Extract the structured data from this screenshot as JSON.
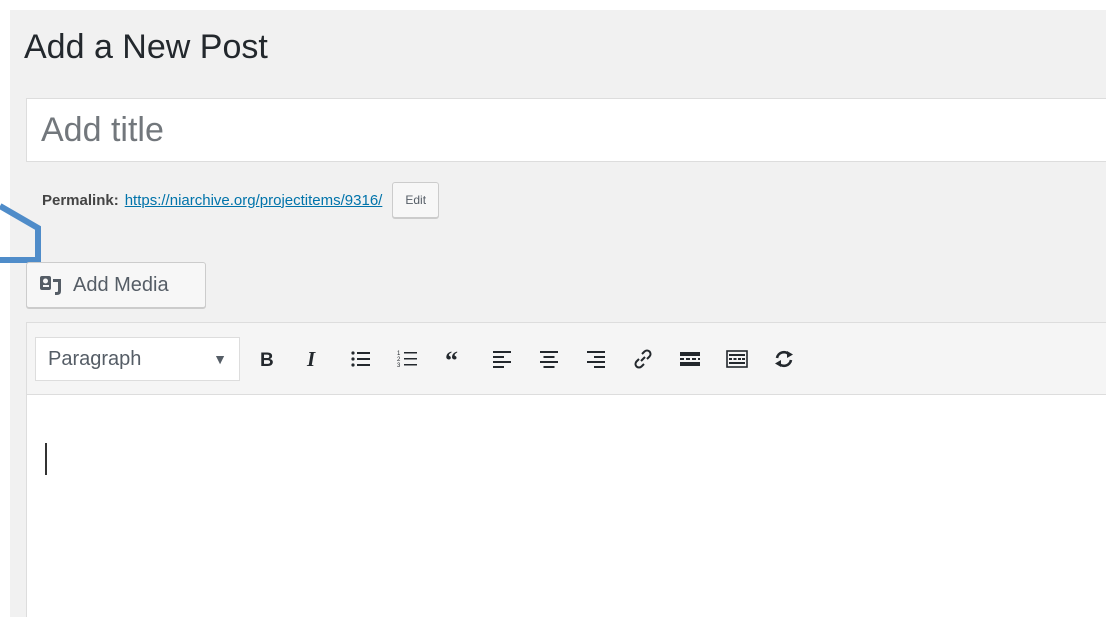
{
  "page": {
    "title": "Add a New Post"
  },
  "title_field": {
    "placeholder": "Add title",
    "value": ""
  },
  "permalink": {
    "label": "Permalink:",
    "url": "https://niarchive.org/projectitems/9316/",
    "edit_label": "Edit"
  },
  "media": {
    "add_media_label": "Add Media",
    "icon": "media-icon"
  },
  "toolbar": {
    "format_select": {
      "value": "Paragraph",
      "icon": "caret-down-icon"
    },
    "buttons": [
      {
        "name": "bold",
        "icon": "bold-icon"
      },
      {
        "name": "italic",
        "icon": "italic-icon"
      },
      {
        "name": "bulleted-list",
        "icon": "bulleted-list-icon"
      },
      {
        "name": "numbered-list",
        "icon": "numbered-list-icon"
      },
      {
        "name": "blockquote",
        "icon": "blockquote-icon"
      },
      {
        "name": "align-left",
        "icon": "align-left-icon"
      },
      {
        "name": "align-center",
        "icon": "align-center-icon"
      },
      {
        "name": "align-right",
        "icon": "align-right-icon"
      },
      {
        "name": "insert-link",
        "icon": "link-icon"
      },
      {
        "name": "read-more",
        "icon": "read-more-icon"
      },
      {
        "name": "toolbar-toggle",
        "icon": "keyboard-icon"
      },
      {
        "name": "refresh",
        "icon": "refresh-icon"
      }
    ]
  },
  "editor": {
    "content": ""
  },
  "colors": {
    "page_bg": "#f1f1f1",
    "link": "#0073aa",
    "annotation_bracket": "#4f8cc9"
  }
}
